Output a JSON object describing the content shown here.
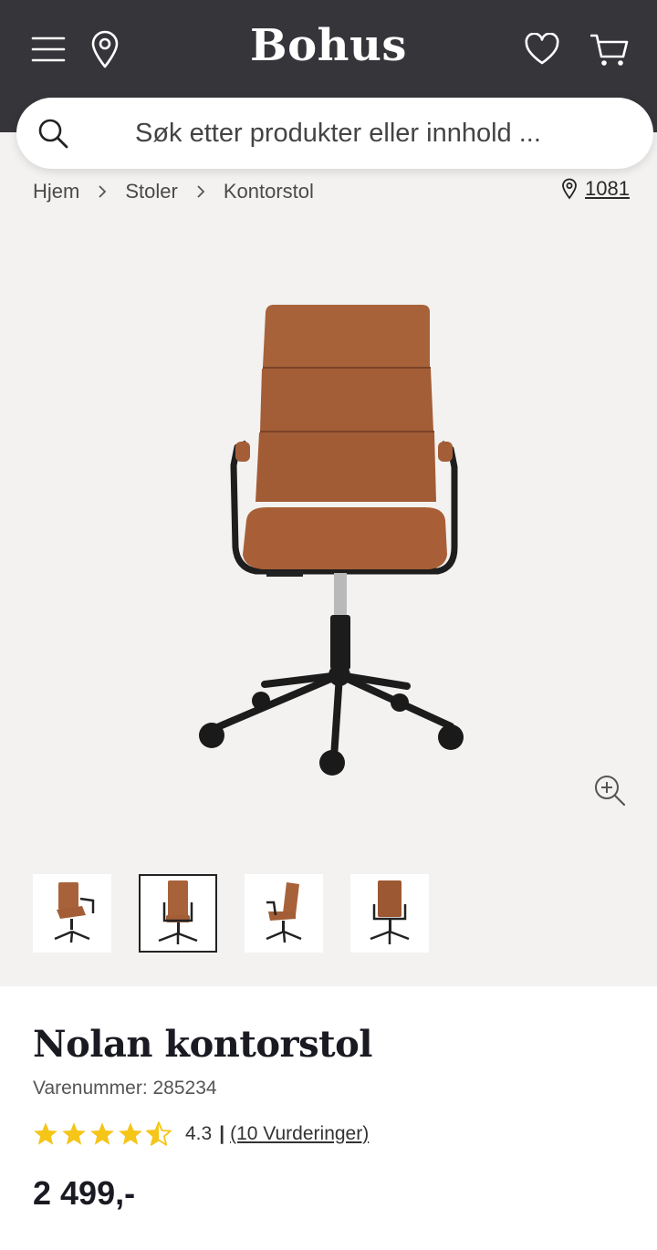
{
  "header": {
    "logo": "Bohus",
    "icons": [
      "menu-icon",
      "location-pin-icon",
      "heart-icon",
      "cart-icon"
    ]
  },
  "search": {
    "placeholder": "Søk etter produkter eller innhold ..."
  },
  "breadcrumb": {
    "items": [
      "Hjem",
      "Stoler",
      "Kontorstol"
    ],
    "store": "1081"
  },
  "gallery": {
    "thumbnail_count": 4,
    "selected_index": 1
  },
  "product": {
    "title": "Nolan kontorstol",
    "sku": "Varenummer: 285234",
    "rating_value": 4.3,
    "rating_text": "4.3",
    "rating_separator": "|",
    "reviews": "(10 Vurderinger)",
    "price": "2 499,-"
  },
  "colors": {
    "header_bg": "#35353a",
    "page_bg": "#f4f2f0",
    "star": "#f5c518",
    "chair_leather": "#a8623a"
  }
}
